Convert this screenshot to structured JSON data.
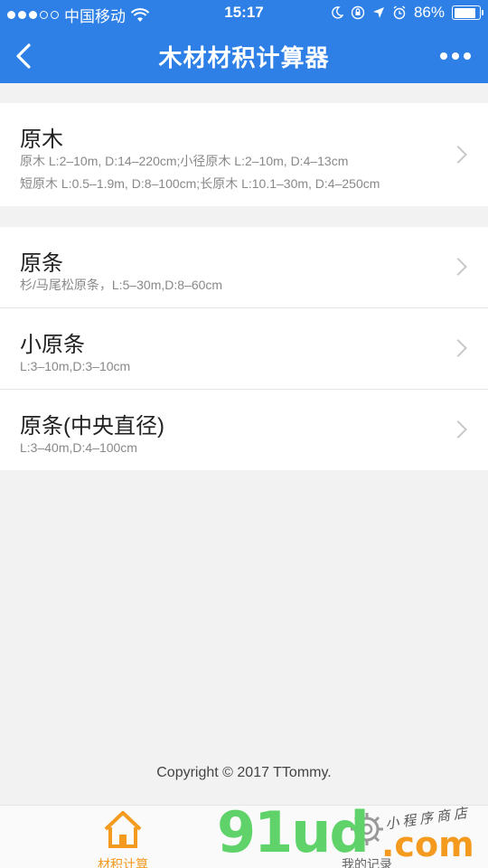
{
  "status_bar": {
    "carrier": "中国移动",
    "time": "15:17",
    "battery": "86%",
    "battery_level": 0.86
  },
  "header": {
    "title": "木材材积计算器"
  },
  "groups": [
    {
      "items": [
        {
          "name": "原木",
          "desc": [
            "原木 L:2–10m, D:14–220cm;小径原木 L:2–10m, D:4–13cm",
            "短原木 L:0.5–1.9m, D:8–100cm;长原木 L:10.1–30m, D:4–250cm"
          ]
        }
      ]
    },
    {
      "items": [
        {
          "name": "原条",
          "desc": [
            "杉/马尾松原条，L:5–30m,D:8–60cm"
          ]
        },
        {
          "name": "小原条",
          "desc": [
            "L:3–10m,D:3–10cm"
          ]
        },
        {
          "name": "原条(中央直径)",
          "desc": [
            "L:3–40m,D:4–100cm"
          ]
        }
      ]
    }
  ],
  "footer": {
    "copyright": "Copyright © 2017 TTommy."
  },
  "tabbar": {
    "tabs": [
      {
        "label": "材积计算",
        "active": true
      },
      {
        "label": "我的记录",
        "active": false
      }
    ]
  },
  "watermark": {
    "brand": "91ud",
    "domain": ".com",
    "tagline": "小程序商店"
  },
  "colors": {
    "primary": "#2f80e6",
    "accent": "#f39a1f",
    "watermark_green": "#5fd36a"
  }
}
